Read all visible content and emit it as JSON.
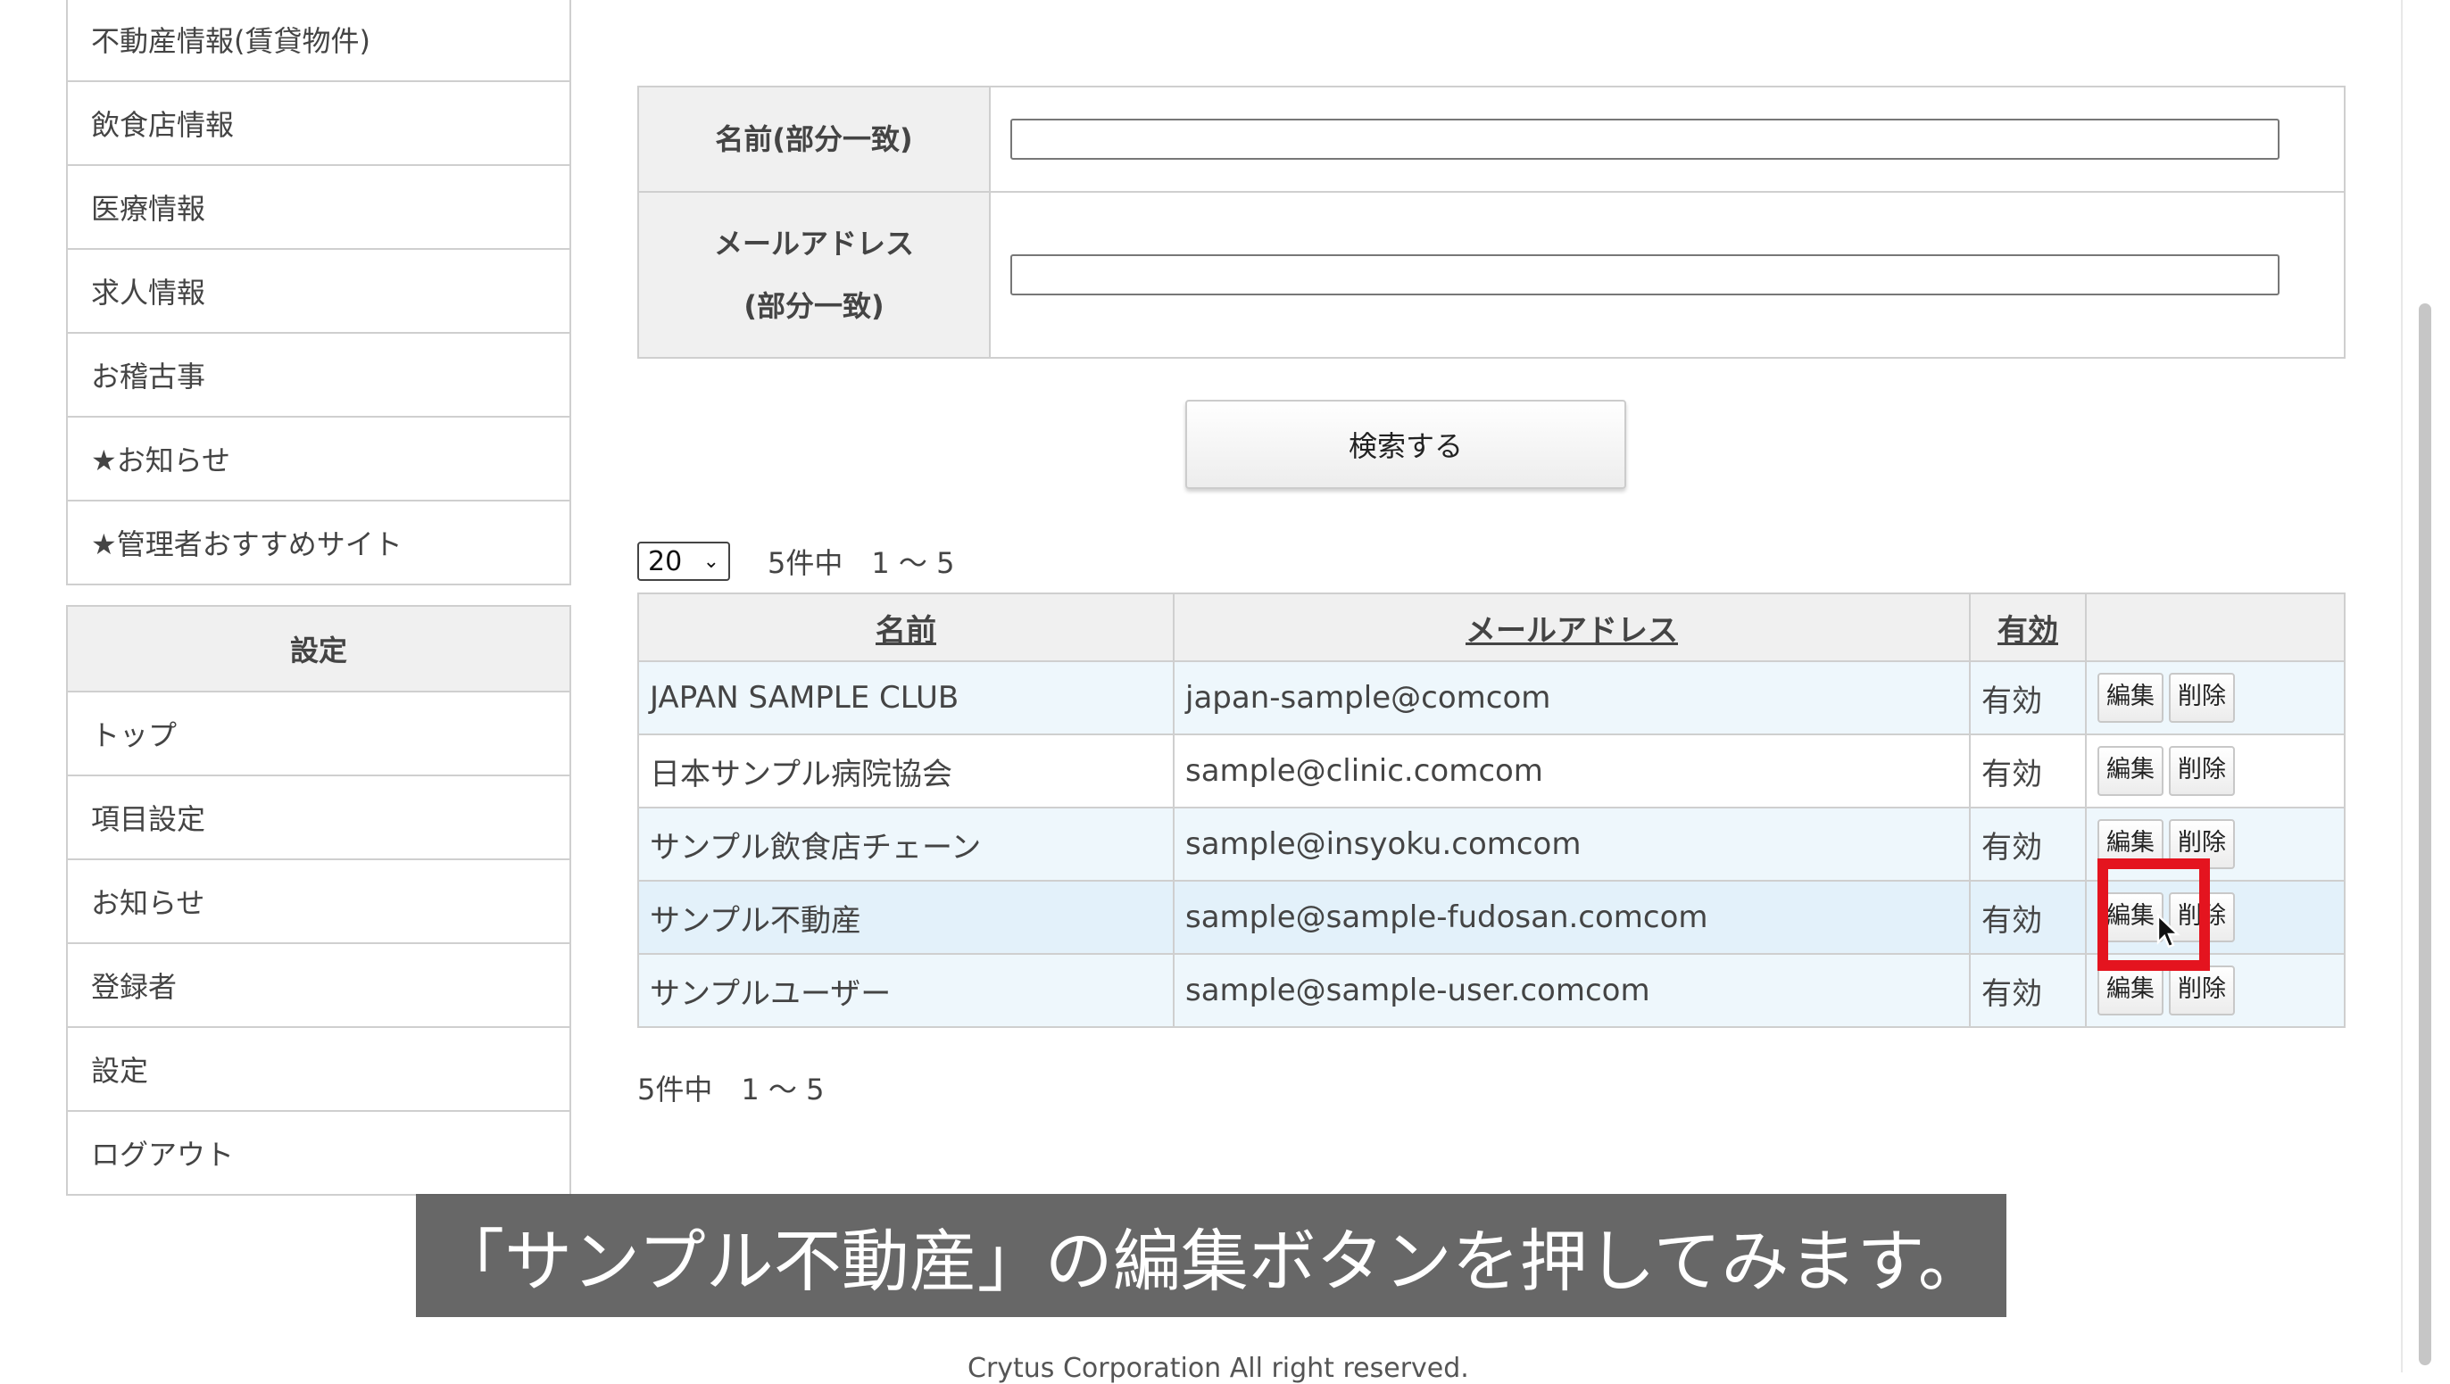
{
  "sidebar_top": {
    "items": [
      "不動産情報(賃貸物件)",
      "飲食店情報",
      "医療情報",
      "求人情報",
      "お稽古事",
      "★お知らせ",
      "★管理者おすすめサイト"
    ]
  },
  "sidebar_settings": {
    "title": "設定",
    "items": [
      "トップ",
      "項目設定",
      "お知らせ",
      "登録者",
      "設定",
      "ログアウト"
    ]
  },
  "search_form": {
    "name_label": "名前(部分一致)",
    "email_label_line1": "メールアドレス",
    "email_label_line2": "(部分一致)",
    "name_value": "",
    "email_value": "",
    "submit_label": "検索する"
  },
  "pagination": {
    "per_page": "20",
    "summary": "5件中　1 〜 5"
  },
  "results": {
    "headers": [
      "名前",
      "メールアドレス",
      "有効",
      ""
    ],
    "edit_label": "編集",
    "delete_label": "削除",
    "rows": [
      {
        "name": "JAPAN SAMPLE CLUB",
        "email": "japan-sample@comcom",
        "status": "有効"
      },
      {
        "name": "日本サンプル病院協会",
        "email": "sample@clinic.comcom",
        "status": "有効"
      },
      {
        "name": "サンプル飲食店チェーン",
        "email": "sample@insyoku.comcom",
        "status": "有効"
      },
      {
        "name": "サンプル不動産",
        "email": "sample@sample-fudosan.comcom",
        "status": "有効"
      },
      {
        "name": "サンプルユーザー",
        "email": "sample@sample-user.comcom",
        "status": "有効"
      }
    ]
  },
  "caption": "「サンプル不動産」の編集ボタンを押してみます。",
  "footer": "Crytus Corporation All right reserved.",
  "colors": {
    "highlight_box": "#e4141f",
    "row_alt": "#eef7fc"
  }
}
